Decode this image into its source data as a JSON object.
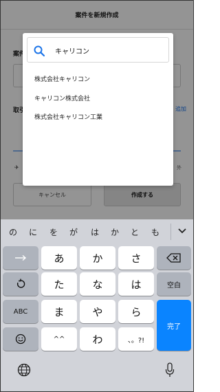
{
  "app": {
    "title": "案件を新規作成",
    "label_project": "案件",
    "label_client": "取引",
    "add_link": "追加",
    "option_text": "外",
    "cancel_label": "キャンセル",
    "create_label": "作成する"
  },
  "popup": {
    "search_value": "キャリコン",
    "suggestions": [
      "株式会社キャリコン",
      "キャリコン株式会社",
      "株式会社キャリコン工業"
    ]
  },
  "keyboard": {
    "candidates": [
      "の",
      "に",
      "を",
      "が",
      "は",
      "か",
      "と",
      "も"
    ],
    "row1": [
      "あ",
      "か",
      "さ"
    ],
    "row2": [
      "た",
      "な",
      "は"
    ],
    "row3": [
      "ま",
      "や",
      "ら"
    ],
    "row4": [
      "^^",
      "わ",
      "、。?!"
    ],
    "space_label": "空白",
    "abc_label": "ABC",
    "done_label": "完了"
  }
}
